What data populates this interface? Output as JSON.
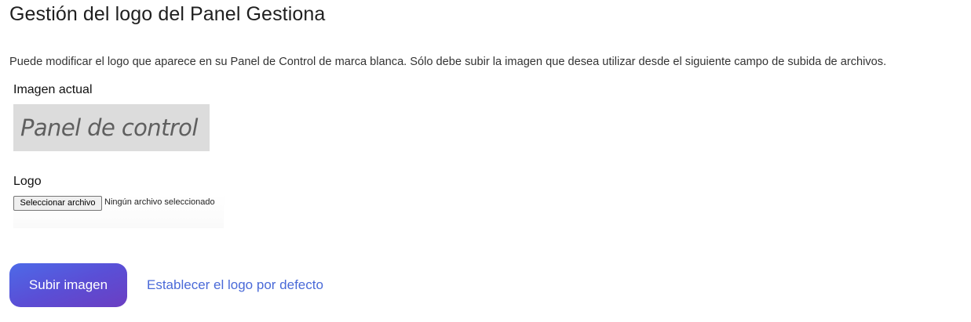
{
  "page": {
    "title": "Gestión del logo del Panel Gestiona",
    "description": "Puede modificar el logo que aparece en su Panel de Control de marca blanca. Sólo debe subir la imagen que desea utilizar desde el siguiente campo de subida de archivos."
  },
  "current_image": {
    "label": "Imagen actual",
    "logo_text": "Panel de control"
  },
  "logo_field": {
    "label": "Logo",
    "button_label": "Seleccionar archivo",
    "status": "Ningún archivo seleccionado"
  },
  "actions": {
    "submit_label": "Subir imagen",
    "default_link": "Establecer el logo por defecto"
  },
  "colors": {
    "button_gradient_start": "#4d6ae8",
    "button_gradient_end": "#6b3ec2",
    "link": "#4a6ad8",
    "logo_background": "#dcdcdc"
  }
}
